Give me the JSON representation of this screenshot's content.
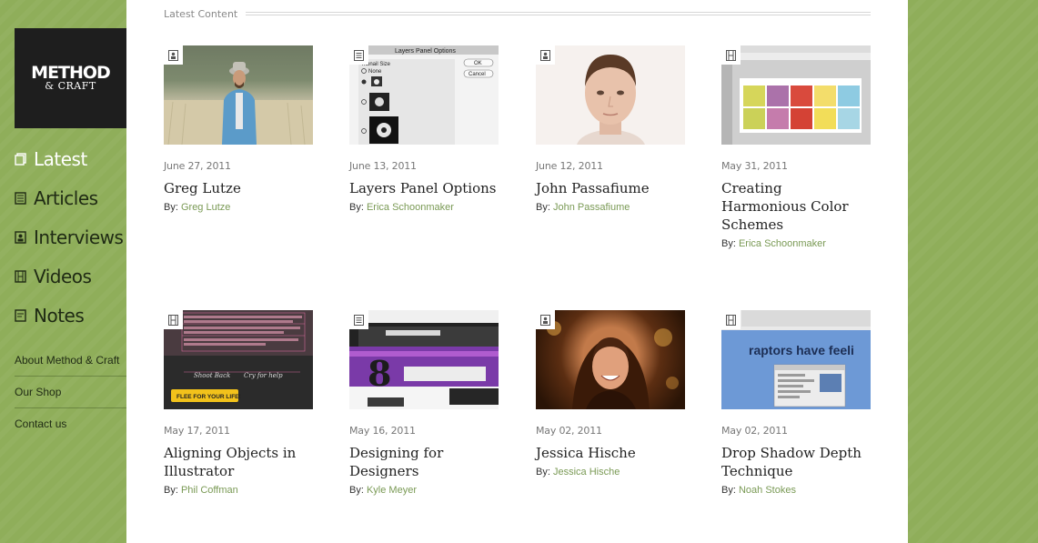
{
  "brand": {
    "line1": "METHOD",
    "line2": "& CRAFT"
  },
  "nav": [
    {
      "label": "Latest",
      "icon": "latest-icon",
      "active": true
    },
    {
      "label": "Articles",
      "icon": "article-icon"
    },
    {
      "label": "Interviews",
      "icon": "interview-icon"
    },
    {
      "label": "Videos",
      "icon": "video-icon"
    },
    {
      "label": "Notes",
      "icon": "note-icon"
    }
  ],
  "subnav": [
    "About Method & Craft",
    "Our Shop",
    "Contact us"
  ],
  "section_title": "Latest Content",
  "by_prefix": "By:",
  "cards": [
    {
      "type": "interview",
      "date": "June 27, 2011",
      "title": "Greg Lutze",
      "author": "Greg Lutze"
    },
    {
      "type": "article",
      "date": "June 13, 2011",
      "title": "Layers Panel Options",
      "author": "Erica Schoonmaker"
    },
    {
      "type": "interview",
      "date": "June 12, 2011",
      "title": "John Passafiume",
      "author": "John Passafiume"
    },
    {
      "type": "video",
      "date": "May 31, 2011",
      "title": "Creating Harmonious Color Schemes",
      "author": "Erica Schoonmaker"
    },
    {
      "type": "video",
      "date": "May 17, 2011",
      "title": "Aligning Objects in Illustrator",
      "author": "Phil Coffman"
    },
    {
      "type": "article",
      "date": "May 16, 2011",
      "title": "Designing for Designers",
      "author": "Kyle Meyer"
    },
    {
      "type": "interview",
      "date": "May 02, 2011",
      "title": "Jessica Hische",
      "author": "Jessica Hische"
    },
    {
      "type": "video",
      "date": "May 02, 2011",
      "title": "Drop Shadow Depth Technique",
      "author": "Noah Stokes"
    }
  ],
  "thumb_text": {
    "layers_dialog_title": "Layers Panel Options",
    "layers_thumb_size": "mbnail Size",
    "layers_none": "None",
    "layers_ok": "OK",
    "layers_cancel": "Cancel",
    "align_line1": "Shoot Back",
    "align_line2": "Cry for help",
    "align_button": "FLEE FOR YOUR LIFE!",
    "drop_text": "raptors have feeli"
  }
}
